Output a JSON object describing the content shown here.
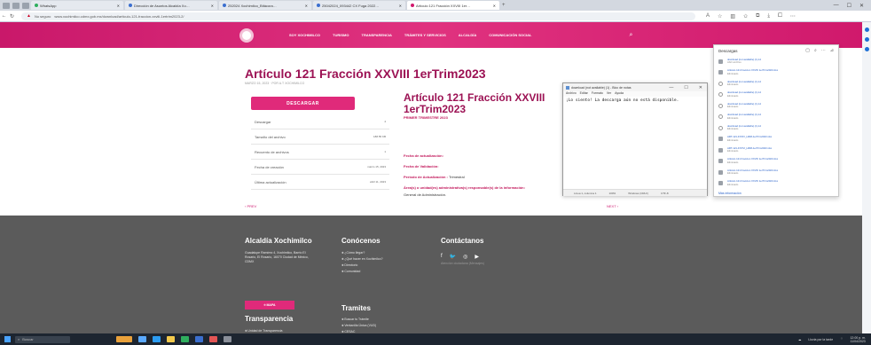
{
  "browser": {
    "tabs": [
      {
        "label": "WhatsApp",
        "active": false,
        "favicon": "green"
      },
      {
        "label": "Dirección de Asuntos Alcaldía Xo…",
        "active": false,
        "favicon": "blue"
      },
      {
        "label": "252024 Xochimilco_Bitácora…",
        "active": false,
        "favicon": "blue"
      },
      {
        "label": "25042024_093442 CX Fuga 2022…",
        "active": false,
        "favicon": "blue"
      },
      {
        "label": "Artículo 121 Fracción XXVIII 1er…",
        "active": true,
        "favicon": "pink"
      }
    ],
    "url_warning": "No seguro",
    "url": "www.xochimilco.cdmx.gob.mx/download/articulo-121-fraccion-xxviii-1ertrim2023-2/"
  },
  "site": {
    "menu": [
      "SOY XOCHIMILCO",
      "TURISMO",
      "TRANSPARENCIA",
      "TRÁMITES Y SERVICIOS",
      "ALCALDÍA",
      "COMUNICACIÓN SOCIAL"
    ]
  },
  "article": {
    "title": "Artículo 121 Fracción XXVIII 1erTrim2023",
    "meta": "MARZO 15, 2023  ·  POR A.T XOCHIMILCO",
    "download_button": "DESCARGAR",
    "file_rows": [
      {
        "label": "Descargar",
        "value": "4"
      },
      {
        "label": "Tamaño del archivo",
        "value": "188.55 KB"
      },
      {
        "label": "Recuento de archivos",
        "value": "1"
      },
      {
        "label": "Fecha de creación",
        "value": "marzo 15, 2023"
      },
      {
        "label": "Última actualización",
        "value": "abril 11, 2023"
      }
    ],
    "subtitle": "Artículo 121 Fracción XXVIII 1erTrim2023",
    "first": "PRIMER TRIMESTRE 2023",
    "info": [
      {
        "label": "Fecha de actualización:",
        "value": ""
      },
      {
        "label": "Fecha de Validación:",
        "value": ""
      },
      {
        "label": "Periodo de Actualización :",
        "value": "Trimestral"
      },
      {
        "label": "Área(s) o unidad(es) administrativa(s) responsable(s) de la información:",
        "value": ""
      }
    ],
    "area_value": "General de Administración.",
    "prev": "‹  PREV",
    "next": "NEXT  ›"
  },
  "footer": {
    "col1_title": "Alcaldía Xochimilco",
    "address": "Guadalupe Ramírez 4, Xochimilco, Barrio El Rosario, El Rosario, 16070 Ciudad de México, CDMX",
    "map_button": "MAPA",
    "col2_title": "Conócenos",
    "col2_items": [
      "¿Cómo llegar?",
      "¿Qué hacer en Xochimilco?",
      "Directorio",
      "Comunidad"
    ],
    "col3_title": "Contáctanos",
    "col3_text": "Atención ciudadana (Mensajes)",
    "transparency_title": "Transparencia",
    "transparency_items": [
      "Unidad de Transparencia",
      "Acciones de Gobierno",
      "SIPOT",
      "INAI"
    ],
    "tramites_title": "Tramites",
    "tramites_items": [
      "Buscar tu Trámite",
      "Ventanilla Única (VUD)",
      "CESAC"
    ]
  },
  "notepad": {
    "title": "download (not available) (1) - Bloc de notas",
    "menu": [
      "Archivo",
      "Editar",
      "Formato",
      "Ver",
      "Ayuda"
    ],
    "body": "¡Lo siento! La descarga aún no está disponible.",
    "status": [
      "Línea 1, columna 1",
      "100%",
      "Windows (CRLF)",
      "UTF-8"
    ]
  },
  "downloads": {
    "title": "Descargas",
    "items": [
      {
        "name": "download (not available) (1).txt",
        "sub": "Abrir archivo",
        "failed": false
      },
      {
        "name": "Articulo 121 Fraccion XXVIII 1erTrim2023.xlsx",
        "sub": "Eliminado",
        "failed": false
      },
      {
        "name": "download (not available) (1).txt",
        "sub": "Eliminado",
        "failed": true
      },
      {
        "name": "download (not available) (1).txt",
        "sub": "Eliminado",
        "failed": true
      },
      {
        "name": "download (not available) (1).txt",
        "sub": "Eliminado",
        "failed": true
      },
      {
        "name": "download (not available) (1).txt",
        "sub": "Eliminado",
        "failed": true
      },
      {
        "name": "download (not available) (1).txt",
        "sub": "Eliminado",
        "failed": true
      },
      {
        "name": "ART-121-FXXIV_HRM-1erTrim2023.xlsx",
        "sub": "Eliminado",
        "failed": false
      },
      {
        "name": "ART-121-FXXVI_HRM-1erTrim2023.xlsx",
        "sub": "Eliminado",
        "failed": false
      },
      {
        "name": "Articulo 121 Fraccion XXVIII 1erTrim2023.xlsx",
        "sub": "Eliminado",
        "failed": false
      },
      {
        "name": "Articulo 121 Fraccion XXVIII 1erTrim2023.xlsx",
        "sub": "Eliminado",
        "failed": false
      },
      {
        "name": "Articulo 121 Fraccion XXVIII 1erTrim2023.xlsx",
        "sub": "Eliminado",
        "failed": false
      }
    ],
    "more": "Más información"
  },
  "taskbar": {
    "search": "Buscar",
    "weather": "Lluvia por la tarde",
    "time": "12:00 p. m.",
    "date": "11/04/2023"
  },
  "colors": {
    "brand": "#d1196d",
    "title": "#9c1254",
    "footer": "#5b5b5b"
  }
}
